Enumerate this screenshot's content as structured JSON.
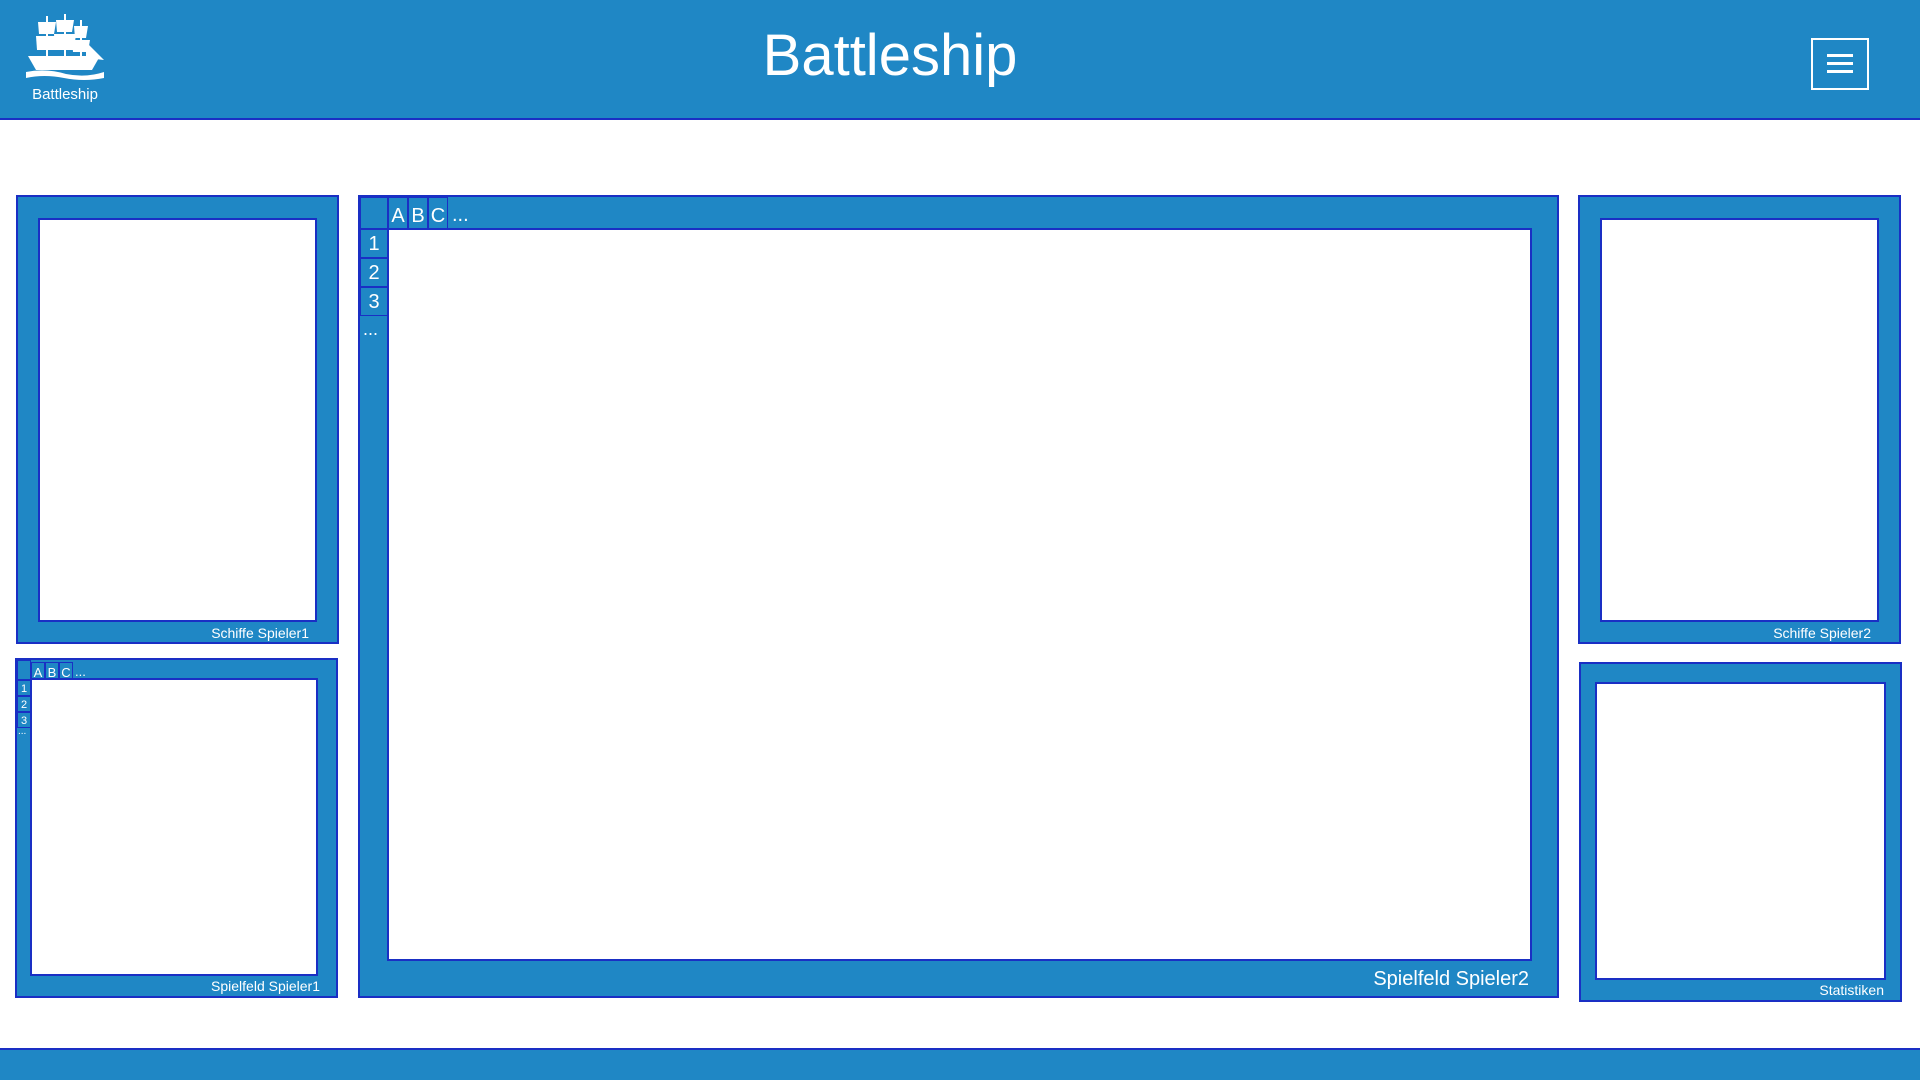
{
  "header": {
    "logo_label": "Battleship",
    "title": "Battleship",
    "menu_icon": "hamburger-menu-icon"
  },
  "panels": {
    "ships_p1": {
      "caption": "Schiffe Spieler1"
    },
    "field_p1": {
      "caption": "Spielfeld Spieler1",
      "columns": [
        "A",
        "B",
        "C",
        "..."
      ],
      "rows": [
        "1",
        "2",
        "3",
        "..."
      ]
    },
    "field_p2": {
      "caption": "Spielfeld Spieler2",
      "columns": [
        "A",
        "B",
        "C",
        "..."
      ],
      "rows": [
        "1",
        "2",
        "3",
        "..."
      ]
    },
    "ships_p2": {
      "caption": "Schiffe Spieler2"
    },
    "stats": {
      "caption": "Statistiken"
    }
  },
  "colors": {
    "primary": "#1f87c5",
    "border": "#1a2fc4",
    "background": "#ffffff"
  }
}
